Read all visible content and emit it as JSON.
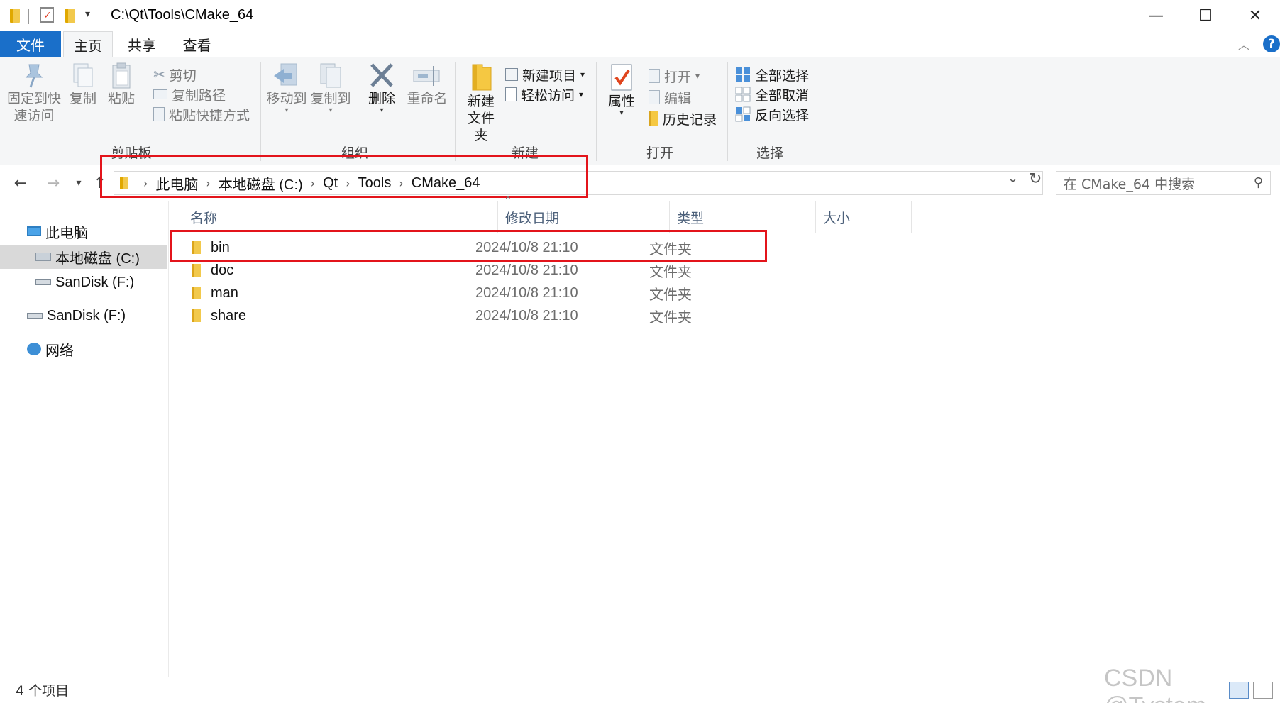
{
  "window": {
    "title": "C:\\Qt\\Tools\\CMake_64",
    "minimize": "—",
    "maximize": "☐",
    "close": "✕"
  },
  "ribbon_tabs": {
    "file": "文件",
    "home": "主页",
    "share": "共享",
    "view": "查看",
    "help": "?"
  },
  "clipboard": {
    "pin": "固定到快\n速访问",
    "pin_line1": "固定到快",
    "pin_line2": "速访问",
    "copy": "复制",
    "paste": "粘贴",
    "cut": "剪切",
    "copy_path": "复制路径",
    "paste_shortcut": "粘贴快捷方式",
    "group_label": "剪贴板"
  },
  "organize": {
    "move_to": "移动到",
    "copy_to": "复制到",
    "delete": "删除",
    "rename": "重命名",
    "group_label": "组织"
  },
  "new_group": {
    "new_folder_line1": "新建",
    "new_folder_line2": "文件夹",
    "new_item": "新建项目",
    "easy_access": "轻松访问",
    "group_label": "新建"
  },
  "open_group": {
    "properties": "属性",
    "open": "打开",
    "edit": "编辑",
    "history": "历史记录",
    "group_label": "打开"
  },
  "select_group": {
    "select_all": "全部选择",
    "select_none": "全部取消",
    "invert": "反向选择",
    "group_label": "选择"
  },
  "address": {
    "crumbs": [
      "此电脑",
      "本地磁盘 (C:)",
      "Qt",
      "Tools",
      "CMake_64"
    ],
    "search_placeholder": "在 CMake_64 中搜索"
  },
  "nav_pane": {
    "items": [
      {
        "label": "此电脑",
        "icon": "computer-icon"
      },
      {
        "label": "本地磁盘 (C:)",
        "icon": "drive-icon",
        "selected": true
      },
      {
        "label": "SanDisk (F:)",
        "icon": "usb-drive-icon"
      },
      {
        "label": "SanDisk (F:)",
        "icon": "usb-drive-icon"
      },
      {
        "label": "网络",
        "icon": "network-icon"
      }
    ]
  },
  "file_list": {
    "columns": [
      "名称",
      "修改日期",
      "类型",
      "大小"
    ],
    "rows": [
      {
        "name": "bin",
        "date": "2024/10/8 21:10",
        "type": "文件夹"
      },
      {
        "name": "doc",
        "date": "2024/10/8 21:10",
        "type": "文件夹"
      },
      {
        "name": "man",
        "date": "2024/10/8 21:10",
        "type": "文件夹"
      },
      {
        "name": "share",
        "date": "2024/10/8 21:10",
        "type": "文件夹"
      }
    ]
  },
  "status": {
    "item_count": "4 个项目"
  },
  "watermark": "CSDN @Tystem",
  "colors": {
    "accent": "#1a6fc9",
    "annotation": "#e3141b",
    "folder": "#f2c94c"
  }
}
